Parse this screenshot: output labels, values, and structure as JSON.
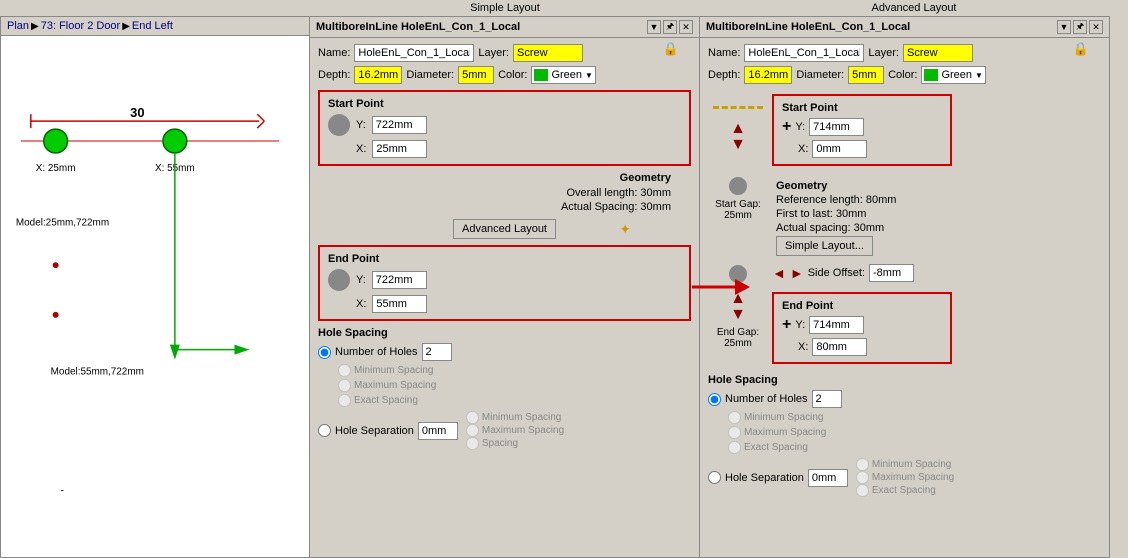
{
  "topLabels": {
    "simple": "Simple Layout",
    "advanced": "Advanced Layout"
  },
  "breadcrumb": {
    "plan": "Plan",
    "separator1": "▶",
    "item1": "73: Floor 2 Door",
    "separator2": "▶",
    "item2": "End Left"
  },
  "simplePanel": {
    "title": "MultiboreInLine HoleEnL_Con_1_Local",
    "titleDropdownBtn": "▼",
    "pinBtn": "🖈",
    "closeBtn": "✕",
    "lockIcon": "🔒",
    "nameLabel": "Name:",
    "nameValue": "HoleEnL_Con_1_Local",
    "layerLabel": "Layer:",
    "layerValue": "Screw",
    "depthLabel": "Depth:",
    "depthValue": "16.2mm",
    "diameterLabel": "Diameter:",
    "diameterValue": "5mm",
    "colorLabel": "Color:",
    "colorValue": "Green",
    "startPointTitle": "Start Point",
    "startPointY_label": "Y:",
    "startPointY_value": "722mm",
    "startPointX_label": "X:",
    "startPointX_value": "25mm",
    "geometryTitle": "Geometry",
    "overallLength": "Overall length: 30mm",
    "actualSpacing": "Actual Spacing: 30mm",
    "advLayoutBtn": "Advanced Layout",
    "endPointTitle": "End Point",
    "endPointY_label": "Y:",
    "endPointY_value": "722mm",
    "endPointX_label": "X:",
    "endPointX_value": "55mm",
    "holeSpacingTitle": "Hole Spacing",
    "numberOfHolesLabel": "Number of Holes",
    "numberOfHolesValue": "2",
    "holeSeparationLabel": "Hole Separation",
    "holeSeparationValue": "0mm",
    "minimumSpacingLabel": "Minimum Spacing",
    "maximumSpacingLabel": "Maximum Spacing",
    "exactSpacingLabel": "Exact Spacing",
    "spacingLabel": "Spacing"
  },
  "advancedPanel": {
    "title": "MultiboreInLine HoleEnL_Con_1_Local",
    "titleDropdownBtn": "▼",
    "pinBtn": "🖈",
    "closeBtn": "✕",
    "lockIcon": "🔒",
    "nameLabel": "Name:",
    "nameValue": "HoleEnL_Con_1_Local",
    "layerLabel": "Layer:",
    "layerValue": "Screw",
    "depthLabel": "Depth:",
    "depthValue": "16.2mm",
    "diameterLabel": "Diameter:",
    "diameterValue": "5mm",
    "colorLabel": "Color:",
    "colorValue": "Green",
    "startPointTitle": "Start Point",
    "startPointY_label": "Y:",
    "startPointY_value": "714mm",
    "startPointX_label": "X:",
    "startPointX_value": "0mm",
    "startGapLabel": "Start Gap:",
    "startGapValue": "25mm",
    "geometryTitle": "Geometry",
    "referenceLength": "Reference length: 80mm",
    "firstToLast": "First to last: 30mm",
    "actualSpacing": "Actual spacing: 30mm",
    "simpleLayoutBtn": "Simple Layout...",
    "endGapLabel": "End Gap:",
    "endGapValue": "25mm",
    "endPointTitle": "End Point",
    "endPointY_label": "Y:",
    "endPointY_value": "714mm",
    "endPointX_label": "X:",
    "endPointX_value": "80mm",
    "sideOffsetLabel": "Side Offset:",
    "sideOffsetValue": "-8mm",
    "holeSpacingTitle": "Hole Spacing",
    "numberOfHolesLabel": "Number of Holes",
    "numberOfHolesValue": "2",
    "holeSeparationLabel": "Hole Separation",
    "holeSeparationValue": "0mm",
    "minimumSpacingLabel": "Minimum Spacing",
    "maximumSpacingLabel": "Maximum Spacing",
    "exactSpacingLabel": "Exact Spacing"
  },
  "planView": {
    "measurement30": "30",
    "x25label": "X: 25mm",
    "x55label": "X: 55mm",
    "modelCoord1": "Model:25mm,722mm",
    "modelCoord2": "Model:55mm,722mm"
  }
}
